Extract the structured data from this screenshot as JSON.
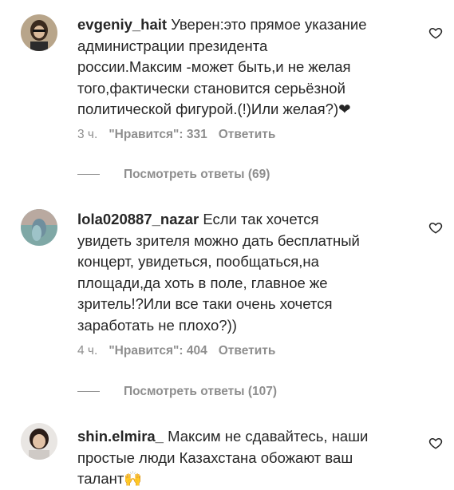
{
  "comments": [
    {
      "username": "evgeniy_hait",
      "text": " Уверен:это прямое указание\nадминистрации президента\nроссии.Максим -может быть,и не желая\nтого,фактически становится серьёзной\nполитической фигурой.(!)Или желая?)❤",
      "time": "3 ч.",
      "likes": "\"Нравится\": 331",
      "reply_label": "Ответить",
      "view_replies": "Посмотреть ответы (69)",
      "avatar_icon": "user-avatar"
    },
    {
      "username": "lola020887_nazar",
      "text": " Если так хочется\nувидеть зрителя можно дать бесплатный\nконцерт, увидеться, пообщаться,на\nплощади,да хоть в поле, главное же\nзритель!?Или все таки очень хочется\nзаработать не плохо?))",
      "time": "4 ч.",
      "likes": "\"Нравится\": 404",
      "reply_label": "Ответить",
      "view_replies": "Посмотреть ответы (107)",
      "avatar_icon": "user-avatar"
    },
    {
      "username": "shin.elmira_",
      "text": " Максим не сдавайтесь, наши\nпростые люди Казахстана обожают ваш\nталант🙌",
      "avatar_icon": "user-avatar"
    }
  ],
  "icons": {
    "like": "heart-outline-icon"
  },
  "colors": {
    "text": "#262626",
    "secondary": "#8e8e8e"
  }
}
